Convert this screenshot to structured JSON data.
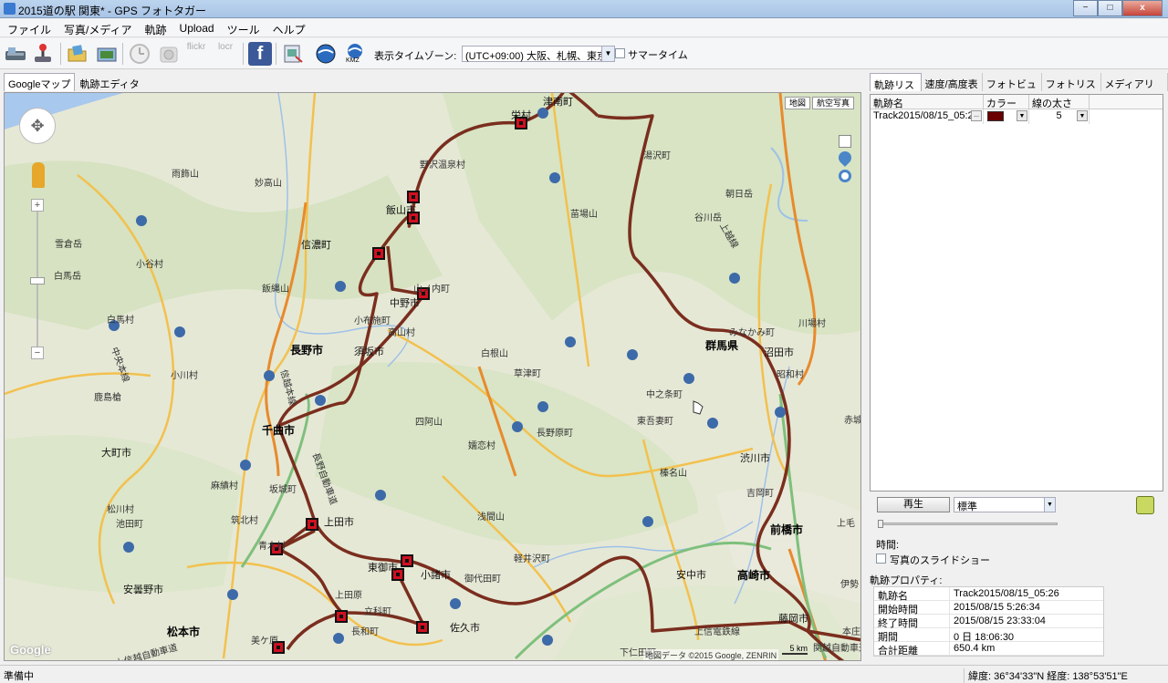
{
  "window": {
    "title": "2015道の駅 関東* - GPS フォトタガー",
    "min": "−",
    "max": "□",
    "close": "x"
  },
  "menu": [
    "ファイル",
    "写真/メディア",
    "軌跡",
    "Upload",
    "ツール",
    "ヘルプ"
  ],
  "toolbar": {
    "icons": [
      "import-gps-icon",
      "joystick-icon",
      "open-folder-icon",
      "photos-icon",
      "clock-icon",
      "camera-icon",
      "flickr-icon",
      "locr-icon",
      "facebook-icon",
      "export-icon",
      "google-earth-icon",
      "kmz-icon"
    ],
    "flickr": "flickr",
    "locr": "locr",
    "facebook": "f",
    "kmz": "KMZ",
    "timezone_label": "表示タイムゾーン:",
    "timezone_value": "(UTC+09:00) 大阪、札幌、東京",
    "dst_label": "サマータイム"
  },
  "left_tabs": [
    "Googleマップ",
    "軌跡エディタ"
  ],
  "map": {
    "type_buttons": [
      "地図",
      "航空写真"
    ],
    "attribution": "地図データ ©2015 Google, ZENRIN",
    "scale": "5 km",
    "google": "Google",
    "labels": [
      {
        "t": "津南町",
        "c": "city"
      },
      {
        "t": "栄村",
        "c": "city"
      },
      {
        "t": "野沢温泉村",
        "c": ""
      },
      {
        "t": "飯山市",
        "c": "city"
      },
      {
        "t": "信濃町",
        "c": "city"
      },
      {
        "t": "山ノ内町",
        "c": ""
      },
      {
        "t": "中野市",
        "c": "city"
      },
      {
        "t": "小布施町",
        "c": ""
      },
      {
        "t": "高山村",
        "c": ""
      },
      {
        "t": "長野市",
        "c": "big"
      },
      {
        "t": "須坂市",
        "c": "city"
      },
      {
        "t": "千曲市",
        "c": "big"
      },
      {
        "t": "坂城町",
        "c": ""
      },
      {
        "t": "上田市",
        "c": "city"
      },
      {
        "t": "東御市",
        "c": "city"
      },
      {
        "t": "小諸市",
        "c": "city"
      },
      {
        "t": "御代田町",
        "c": ""
      },
      {
        "t": "佐久市",
        "c": "city"
      },
      {
        "t": "立科町",
        "c": ""
      },
      {
        "t": "長和町",
        "c": ""
      },
      {
        "t": "青木村",
        "c": ""
      },
      {
        "t": "松本市",
        "c": "big"
      },
      {
        "t": "安曇野市",
        "c": "city"
      },
      {
        "t": "大町市",
        "c": "city"
      },
      {
        "t": "麻績村",
        "c": ""
      },
      {
        "t": "筑北村",
        "c": ""
      },
      {
        "t": "松川村",
        "c": ""
      },
      {
        "t": "池田町",
        "c": ""
      },
      {
        "t": "白馬村",
        "c": ""
      },
      {
        "t": "小谷村",
        "c": ""
      },
      {
        "t": "小川村",
        "c": ""
      },
      {
        "t": "草津町",
        "c": ""
      },
      {
        "t": "長野原町",
        "c": ""
      },
      {
        "t": "嬬恋村",
        "c": ""
      },
      {
        "t": "中之条町",
        "c": ""
      },
      {
        "t": "東吾妻町",
        "c": ""
      },
      {
        "t": "群馬県",
        "c": "big"
      },
      {
        "t": "みなかみ町",
        "c": ""
      },
      {
        "t": "沼田市",
        "c": "city"
      },
      {
        "t": "昭和村",
        "c": ""
      },
      {
        "t": "渋川市",
        "c": "city"
      },
      {
        "t": "吉岡町",
        "c": ""
      },
      {
        "t": "前橋市",
        "c": "big"
      },
      {
        "t": "高崎市",
        "c": "big"
      },
      {
        "t": "安中市",
        "c": "city"
      },
      {
        "t": "軽井沢町",
        "c": ""
      },
      {
        "t": "下仁田町",
        "c": ""
      },
      {
        "t": "藤岡市",
        "c": "city"
      },
      {
        "t": "上信電鉄線",
        "c": ""
      },
      {
        "t": "湯沢町",
        "c": ""
      },
      {
        "t": "谷川岳",
        "c": ""
      },
      {
        "t": "苗場山",
        "c": ""
      },
      {
        "t": "白根山",
        "c": ""
      },
      {
        "t": "四阿山",
        "c": ""
      },
      {
        "t": "浅間山",
        "c": ""
      },
      {
        "t": "榛名山",
        "c": ""
      },
      {
        "t": "雨飾山",
        "c": ""
      },
      {
        "t": "妙高山",
        "c": ""
      },
      {
        "t": "白馬岳",
        "c": ""
      },
      {
        "t": "鹿島槍",
        "c": ""
      },
      {
        "t": "飯縄山",
        "c": ""
      },
      {
        "t": "川場村",
        "c": ""
      },
      {
        "t": "赤城",
        "c": ""
      },
      {
        "t": "上毛",
        "c": ""
      },
      {
        "t": "伊勢",
        "c": ""
      },
      {
        "t": "美ケ原",
        "c": ""
      },
      {
        "t": "上田原",
        "c": ""
      },
      {
        "t": "本庄",
        "c": ""
      },
      {
        "t": "朝日岳",
        "c": ""
      },
      {
        "t": "雪倉岳",
        "c": ""
      },
      {
        "t": "上越線",
        "c": ""
      },
      {
        "t": "上信越自動車道",
        "c": ""
      },
      {
        "t": "中央本線",
        "c": ""
      },
      {
        "t": "信越本線",
        "c": ""
      },
      {
        "t": "長野自動車道",
        "c": ""
      },
      {
        "t": "関越自動車道",
        "c": ""
      }
    ]
  },
  "right_tabs": [
    "軌跡リスト",
    "速度/高度表示",
    "フォトビュー",
    "フォトリスト",
    "メディアリスト"
  ],
  "track_table": {
    "headers": [
      "軌跡名",
      "カラー",
      "線の太さ"
    ],
    "rows": [
      {
        "name": "Track2015/08/15_05:2",
        "color": "#6b0000",
        "width": "5"
      }
    ]
  },
  "playback": {
    "play": "再生",
    "speed": "標準",
    "time_label": "時間:",
    "slideshow_label": "写真のスライドショー",
    "progress": 0
  },
  "props": {
    "title": "軌跡プロパティ:",
    "rows": [
      {
        "k": "軌跡名",
        "v": "Track2015/08/15_05:26"
      },
      {
        "k": "開始時間",
        "v": "2015/08/15 5:26:34"
      },
      {
        "k": "終了時間",
        "v": "2015/08/15 23:33:04"
      },
      {
        "k": "期間",
        "v": "0 日  18:06:30"
      },
      {
        "k": "合計距離",
        "v": "650.4 km"
      }
    ]
  },
  "status": {
    "left": "準備中",
    "right": "緯度: 36°34'33\"N  経度: 138°53'51\"E"
  }
}
